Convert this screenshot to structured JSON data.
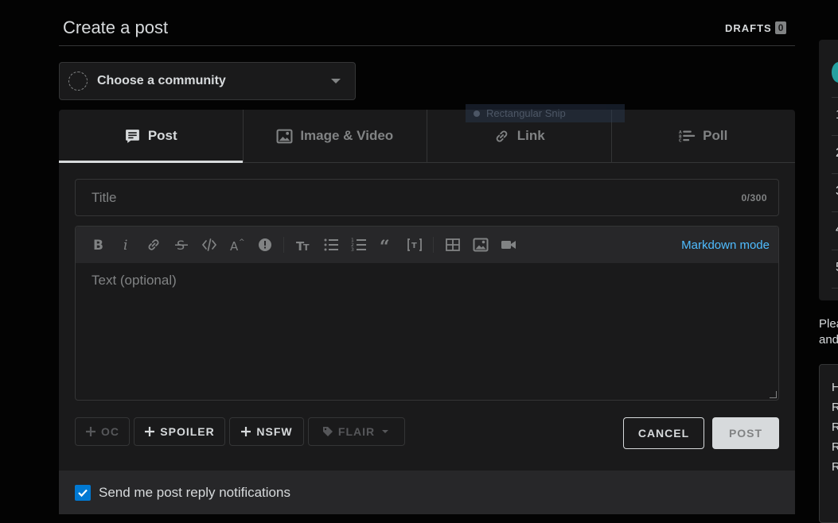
{
  "header": {
    "title": "Create a post",
    "drafts_label": "DRAFTS",
    "drafts_count": "0"
  },
  "community": {
    "label": "Choose a community"
  },
  "ghost_tooltip": {
    "text": "Rectangular Snip"
  },
  "tabs": [
    {
      "label": "Post",
      "icon": "post-icon",
      "active": true
    },
    {
      "label": "Image & Video",
      "icon": "image-icon",
      "active": false
    },
    {
      "label": "Link",
      "icon": "link-icon",
      "active": false
    },
    {
      "label": "Poll",
      "icon": "poll-icon",
      "active": false
    }
  ],
  "title_field": {
    "placeholder": "Title",
    "value": "",
    "counter": "0/300"
  },
  "editor": {
    "toolbar": [
      "bold-icon",
      "italic-icon",
      "link-icon",
      "strikethrough-icon",
      "inline-code-icon",
      "superscript-icon",
      "spoiler-icon",
      "heading-icon",
      "bulleted-list-icon",
      "numbered-list-icon",
      "quote-icon",
      "code-block-icon",
      "table-icon",
      "image-icon",
      "video-icon"
    ],
    "markdown_mode": "Markdown mode",
    "placeholder": "Text (optional)"
  },
  "tags": {
    "oc": "OC",
    "spoiler": "SPOILER",
    "nsfw": "NSFW",
    "flair": "FLAIR"
  },
  "actions": {
    "cancel": "CANCEL",
    "post": "POST"
  },
  "notifications": {
    "label": "Send me post reply notifications",
    "checked": true
  },
  "sidebar": {
    "numbers": [
      "1",
      "2",
      "3",
      "4",
      "5"
    ],
    "note_lines": [
      "Plea",
      "and"
    ],
    "rule_letters": [
      "H",
      "R",
      "R",
      "R",
      "R"
    ]
  },
  "colors": {
    "background": "#030303",
    "card": "#1a1a1b",
    "accent": "#4fbcff",
    "checkbox": "#0079d3"
  }
}
